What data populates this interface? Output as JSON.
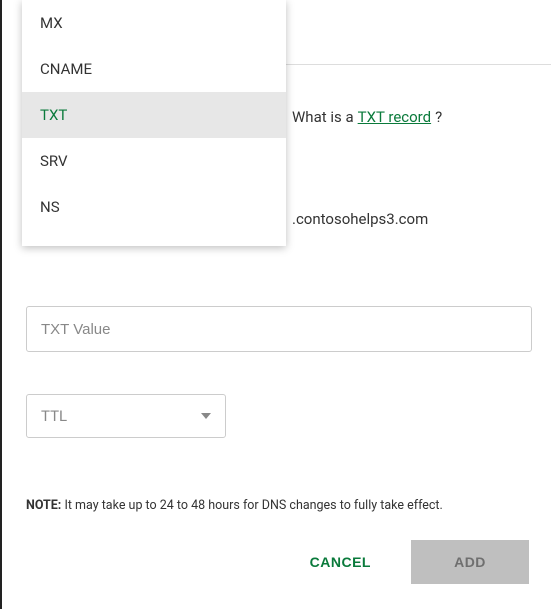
{
  "dropdown": {
    "items": [
      {
        "label": "MX"
      },
      {
        "label": "CNAME"
      },
      {
        "label": "TXT",
        "selected": true
      },
      {
        "label": "SRV"
      },
      {
        "label": "NS"
      }
    ]
  },
  "hint": {
    "prefix": "What is a ",
    "link_text": "TXT record ",
    "suffix": "?"
  },
  "domain_suffix": ".contosohelps3.com",
  "txt_value": {
    "placeholder": "TXT Value",
    "value": ""
  },
  "ttl": {
    "label": "TTL"
  },
  "note": {
    "label": "NOTE:",
    "text": " It may take up to 24 to 48 hours for DNS changes to fully take effect."
  },
  "buttons": {
    "cancel": "CANCEL",
    "add": "ADD"
  }
}
